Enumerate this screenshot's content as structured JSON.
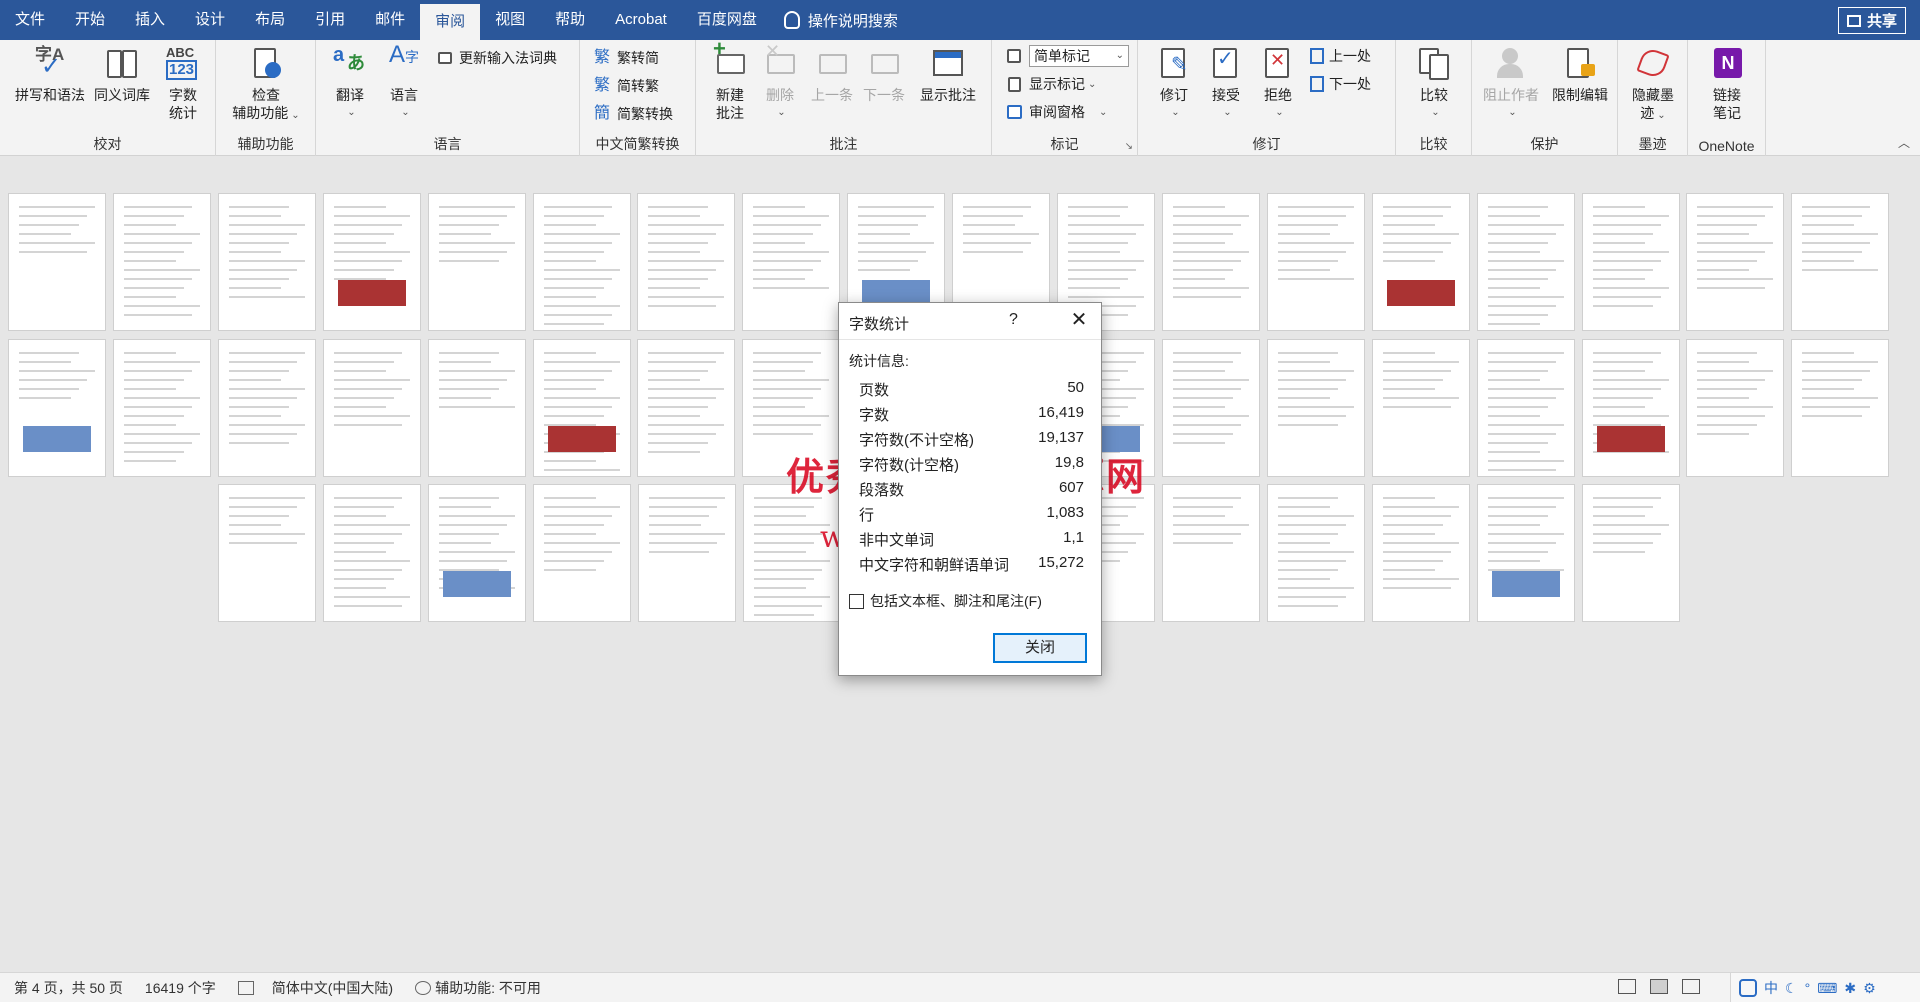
{
  "menu": {
    "items": [
      "文件",
      "开始",
      "插入",
      "设计",
      "布局",
      "引用",
      "邮件",
      "审阅",
      "视图",
      "帮助",
      "Acrobat",
      "百度网盘"
    ],
    "active": "审阅",
    "tell_me": "操作说明搜索",
    "share": "共享"
  },
  "ribbon": {
    "proofing": {
      "label": "校对",
      "spelling": "拼写和语法",
      "thesaurus": "同义词库",
      "wordcount_line1": "字数",
      "wordcount_line2": "统计",
      "icon_abc": "ABC",
      "icon_123": "123"
    },
    "accessibility": {
      "label": "辅助功能",
      "check_line1": "检查",
      "check_line2": "辅助功能"
    },
    "language": {
      "label": "语言",
      "translate": "翻译",
      "language": "语言",
      "update_ime": "更新输入法词典"
    },
    "chinese": {
      "label": "中文简繁转换",
      "to_trad": "繁转简",
      "to_simp": "简转繁",
      "convert": "简繁转换"
    },
    "comments": {
      "label": "批注",
      "new_line1": "新建",
      "new_line2": "批注",
      "delete": "删除",
      "prev": "上一条",
      "next": "下一条",
      "show": "显示批注"
    },
    "tracking": {
      "label": "标记",
      "markup_select": "简单标记",
      "show_markup": "显示标记",
      "review_pane": "审阅窗格"
    },
    "changes": {
      "label": "修订",
      "track": "修订",
      "accept": "接受",
      "reject": "拒绝",
      "prev": "上一处",
      "next": "下一处"
    },
    "compare": {
      "label": "比较",
      "compare": "比较"
    },
    "protect": {
      "label": "保护",
      "block": "阻止作者",
      "restrict": "限制编辑"
    },
    "ink": {
      "label": "墨迹",
      "hide_line1": "隐藏墨",
      "hide_line2": "迹"
    },
    "onenote": {
      "label": "OneNote",
      "link_line1": "链接",
      "link_line2": "笔记",
      "icon": "N"
    }
  },
  "dialog": {
    "title": "字数统计",
    "help": "?",
    "stats_label": "统计信息:",
    "stats": [
      {
        "label": "页数",
        "value": "50"
      },
      {
        "label": "字数",
        "value": "16,419"
      },
      {
        "label": "字符数(不计空格)",
        "value": "19,137"
      },
      {
        "label": "字符数(计空格)",
        "value": "19,8"
      },
      {
        "label": "段落数",
        "value": "607"
      },
      {
        "label": "行",
        "value": "1,083"
      },
      {
        "label": "非中文单词",
        "value": "1,1"
      },
      {
        "label": "中文字符和朝鲜语单词",
        "value": "15,272"
      }
    ],
    "include_label": "包括文本框、脚注和尾注(F)",
    "include_checked": false,
    "close_label": "关闭"
  },
  "watermark": {
    "line1": "优秀毕业设计资源网",
    "line2": "www.keyicad.cn",
    "color": "#d9001b"
  },
  "statusbar": {
    "page": "第 4 页，共 50 页",
    "words": "16419 个字",
    "language": "简体中文(中国大陆)",
    "accessibility": "辅助功能: 不可用",
    "ime": [
      "中",
      "☾",
      "°",
      "⌨",
      "✱",
      "⚙"
    ]
  },
  "colors": {
    "ribbon_blue": "#2b579a",
    "accent": "#0078d7"
  }
}
